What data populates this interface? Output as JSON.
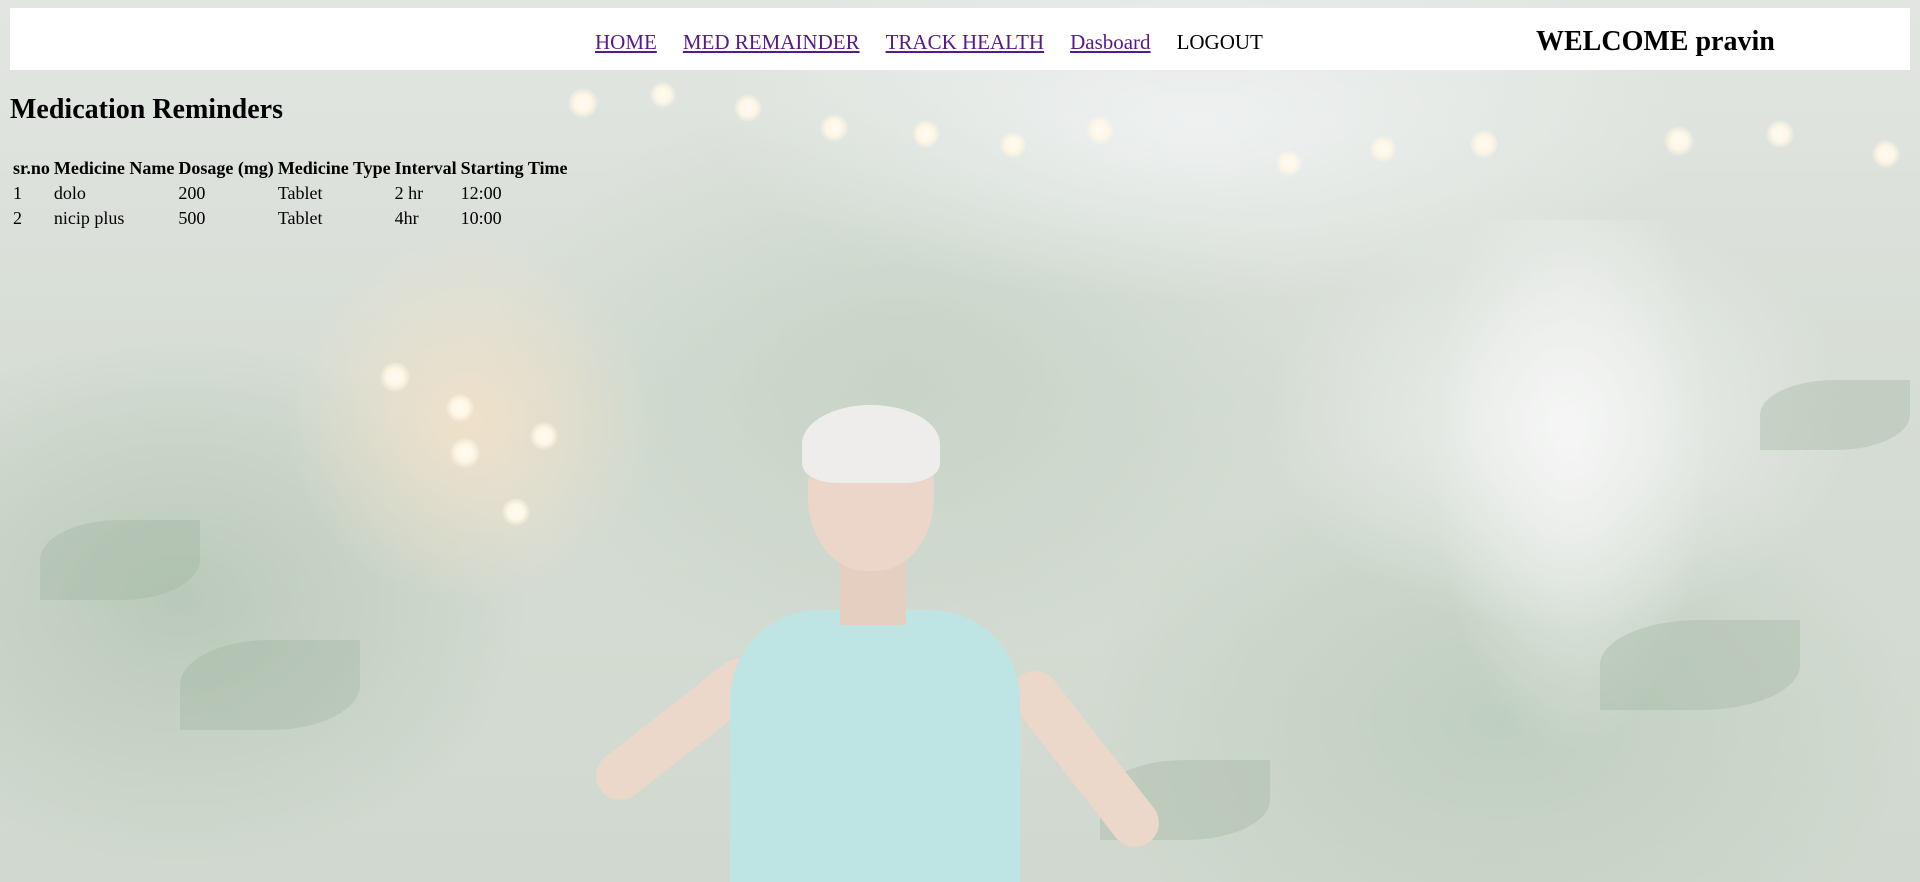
{
  "nav": {
    "items": [
      {
        "label": "HOME"
      },
      {
        "label": "MED REMAINDER"
      },
      {
        "label": "TRACK HEALTH"
      },
      {
        "label": "Dasboard"
      }
    ],
    "logout_label": "LOGOUT",
    "welcome_text": "WELCOME pravin"
  },
  "page": {
    "title": "Medication Reminders"
  },
  "table": {
    "headers": [
      "sr.no",
      "Medicine Name",
      "Dosage (mg)",
      "Medicine Type",
      "Interval",
      "Starting Time"
    ],
    "rows": [
      [
        "1",
        "dolo",
        "200",
        "Tablet",
        "2 hr",
        "12:00"
      ],
      [
        "2",
        "nicip plus",
        "500",
        "Tablet",
        "4hr",
        "10:00"
      ]
    ]
  },
  "colors": {
    "link_visited": "#551a8b",
    "navbar_bg": "#ffffff"
  }
}
